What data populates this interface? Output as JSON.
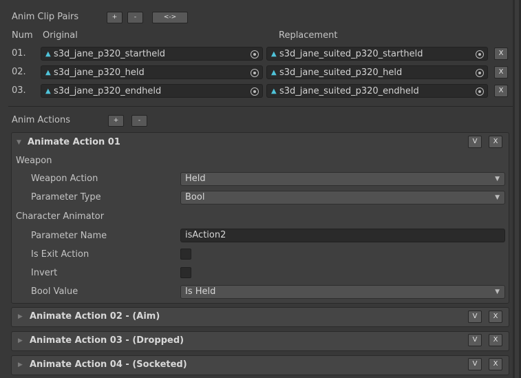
{
  "clip_pairs": {
    "title": "Anim Clip Pairs",
    "buttons": {
      "add": "+",
      "remove": "-",
      "swap": "<->"
    },
    "col_num": "Num",
    "col_original": "Original",
    "col_replacement": "Replacement",
    "rows": [
      {
        "num": "01.",
        "original": "s3d_jane_p320_startheld",
        "replacement": "s3d_jane_suited_p320_startheld",
        "remove": "X"
      },
      {
        "num": "02.",
        "original": "s3d_jane_p320_held",
        "replacement": "s3d_jane_suited_p320_held",
        "remove": "X"
      },
      {
        "num": "03.",
        "original": "s3d_jane_p320_endheld",
        "replacement": "s3d_jane_suited_p320_endheld",
        "remove": "X"
      }
    ]
  },
  "anim_actions": {
    "title": "Anim Actions",
    "buttons": {
      "add": "+",
      "remove": "-"
    },
    "expanded": {
      "fold_icon": "▼",
      "title": "Animate Action 01",
      "v_button": "V",
      "x_button": "X",
      "weapon_section": "Weapon",
      "weapon_action_label": "Weapon Action",
      "weapon_action_value": "Held",
      "parameter_type_label": "Parameter Type",
      "parameter_type_value": "Bool",
      "character_animator_section": "Character Animator",
      "parameter_name_label": "Parameter Name",
      "parameter_name_value": "isAction2",
      "is_exit_action_label": "Is Exit Action",
      "invert_label": "Invert",
      "bool_value_label": "Bool Value",
      "bool_value_value": "Is Held"
    },
    "collapsed": [
      {
        "fold_icon": "▶",
        "title": "Animate Action 02 - (Aim)",
        "v_button": "V",
        "x_button": "X"
      },
      {
        "fold_icon": "▶",
        "title": "Animate Action 03 - (Dropped)",
        "v_button": "V",
        "x_button": "X"
      },
      {
        "fold_icon": "▶",
        "title": "Animate Action 04 - (Socketed)",
        "v_button": "V",
        "x_button": "X"
      }
    ]
  },
  "icons": {
    "clip": "animation-clip-icon",
    "picker": "object-picker-icon",
    "dropdown": "dropdown-arrow-icon"
  },
  "colors": {
    "background": "#383838",
    "field": "#2a2a2a",
    "clip_icon": "#4fc3d9",
    "button": "#585858"
  }
}
